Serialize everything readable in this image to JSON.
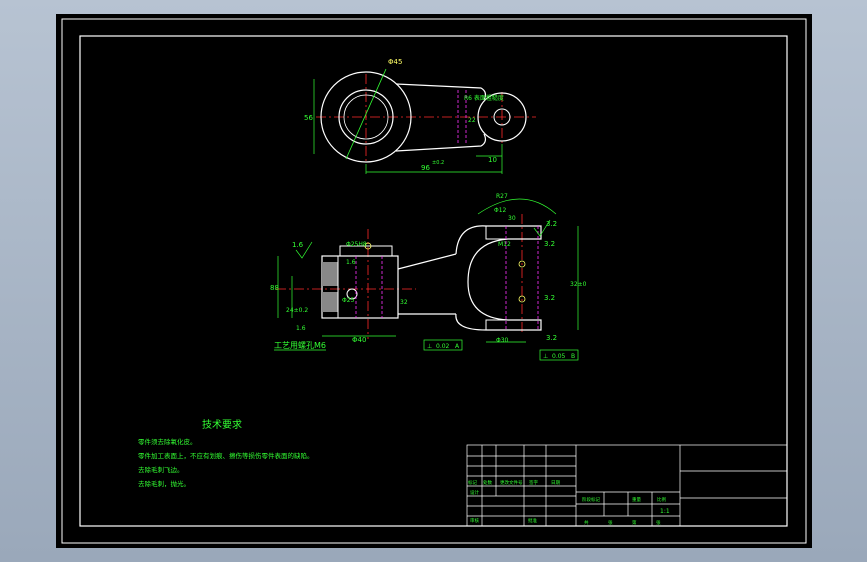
{
  "drawing": {
    "top_view": {
      "dim_hole_big": "Φ45",
      "dim_width": "56",
      "dim_rib_width": "22",
      "dim_small_right": "10",
      "dim_center": "96",
      "dim_center_tol": "±0.2",
      "dim_surface": "R6 表面粗糙度"
    },
    "front_view": {
      "roughness_left": "1.6",
      "dim_bore": "Φ25H8",
      "roughness_bore": "1.6",
      "dim_height": "88",
      "dim_offset": "24±0.2",
      "dim_small": "1.6",
      "dim_top_right": "Φ12",
      "dim_arc": "R27",
      "roughness_right": "3.2",
      "dim_m12": "M12",
      "dim_ra": "3.2",
      "dim_right_height": "32±0",
      "dim_flange": "Φ40",
      "dim_depth": "Φ30",
      "dim_center_bore": "Φ25",
      "tol_left_sym": "⊥",
      "tol_left_value": "0.02",
      "tol_left_datum": "A",
      "tol_right_sym": "⊥",
      "tol_right_value": "0.05",
      "tol_right_datum": "B",
      "note_process": "工艺用螺孔M6",
      "dim_30": "30",
      "dim_32": "32",
      "roughness_small_right": "3.2",
      "roughness_bottom": "3.2"
    }
  },
  "notes": {
    "title": "技术要求",
    "lines": [
      "零件须去除氧化皮。",
      "零件加工表面上，不应有划痕、擦伤等损伤零件表面的缺陷。",
      "去除毛刺飞边。",
      "去除毛刺，抛光。"
    ]
  },
  "title_block": {
    "row_labels": [
      "标记",
      "处数",
      "更改文件号",
      "签字",
      "日期"
    ],
    "row_labels2": [
      "设计",
      "审核"
    ],
    "stage_labels": [
      "阶段标记",
      "重量",
      "比例"
    ],
    "scale": "1:1",
    "bottom_labels": [
      "共",
      "张",
      "第",
      "张"
    ],
    "approve": "批准"
  },
  "colors": {
    "background": "#000000",
    "frame": "#ffffff",
    "geometry": "#ffffff",
    "centerline": "#ff2a2a",
    "dimension": "#33ff33",
    "hidden": "#ff33ff",
    "yellow": "#ffff66"
  }
}
